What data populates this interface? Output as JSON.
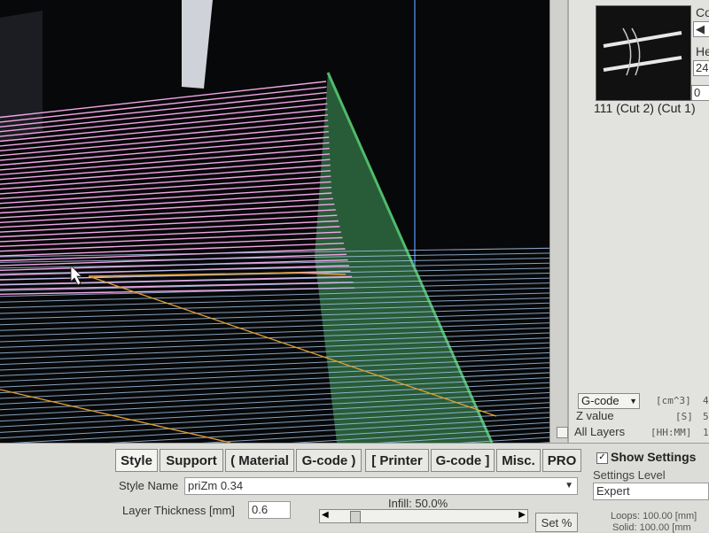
{
  "side_panel": {
    "label_co": "Co",
    "label_he": "He",
    "field_he_value": "24",
    "field_zero_value": "0",
    "layer_name": "111 (Cut 2) (Cut 1)",
    "view_select": "G-code",
    "z_value_label": "Z value",
    "all_layers_label": "All Layers",
    "unit_cm3": "[cm^3]",
    "unit_cm3_value": "4",
    "unit_s": "[S]",
    "unit_s_value": "5",
    "unit_hhmm": "[HH:MM]",
    "unit_hhmm_value": "1"
  },
  "tabs": [
    {
      "label": "Style"
    },
    {
      "label": "Support"
    },
    {
      "label": "( Material"
    },
    {
      "label": "G-code )"
    },
    {
      "label": "[ Printer"
    },
    {
      "label": "G-code ]"
    },
    {
      "label": "Misc."
    },
    {
      "label": "PRO"
    }
  ],
  "style_panel": {
    "style_name_label": "Style Name",
    "style_name_value": "priZm  0.34",
    "layer_thickness_label": "Layer Thickness [mm]",
    "layer_thickness_value": "0.6",
    "infill_label": "Infill: 50.0%",
    "infill_fraction": 0.5,
    "set_percent_label": "Set %"
  },
  "settings_panel": {
    "show_settings_label": "Show Settings",
    "settings_level_label": "Settings Level",
    "settings_level_value": "Expert",
    "loops_label": "Loops: 100.00 [mm]",
    "solid_label": "Solid: 100.00 [mm"
  },
  "colors": {
    "viewport_bg": "#070809",
    "slice_pink": "#f2a6e6",
    "slice_blue": "#a8c8ee",
    "plane_green": "#3a8a52",
    "toolpath_orange": "#e0a030"
  }
}
